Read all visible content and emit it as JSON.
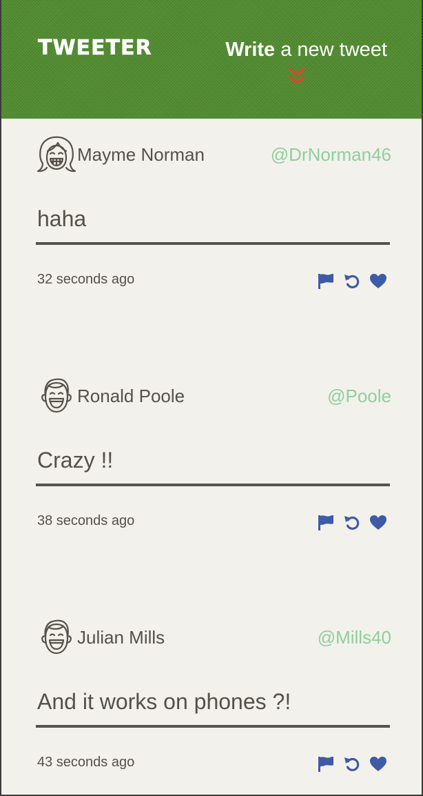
{
  "header": {
    "brand": "TWEETER",
    "compose_strong": "Write",
    "compose_rest": "a new tweet"
  },
  "colors": {
    "header_bg": "#4e8a2c",
    "page_bg": "#f3f1ec",
    "text": "#545149",
    "handle": "#8fcf9c",
    "action_icons": "#3f5aa6",
    "chevron": "#e0442c"
  },
  "tweets": [
    {
      "name": "Mayme Norman",
      "handle": "@DrNorman46",
      "text": "haha",
      "time": "32 seconds ago",
      "avatar_icon": "girl-avatar-icon"
    },
    {
      "name": "Ronald Poole",
      "handle": "@Poole",
      "text": "Crazy !!",
      "time": "38 seconds ago",
      "avatar_icon": "boy-avatar-icon"
    },
    {
      "name": "Julian Mills",
      "handle": "@Mills40",
      "text": "And it works on phones ?!",
      "time": "43 seconds ago",
      "avatar_icon": "boy-avatar-icon"
    }
  ],
  "action_icons": [
    "flag-icon",
    "retweet-icon",
    "heart-icon"
  ]
}
